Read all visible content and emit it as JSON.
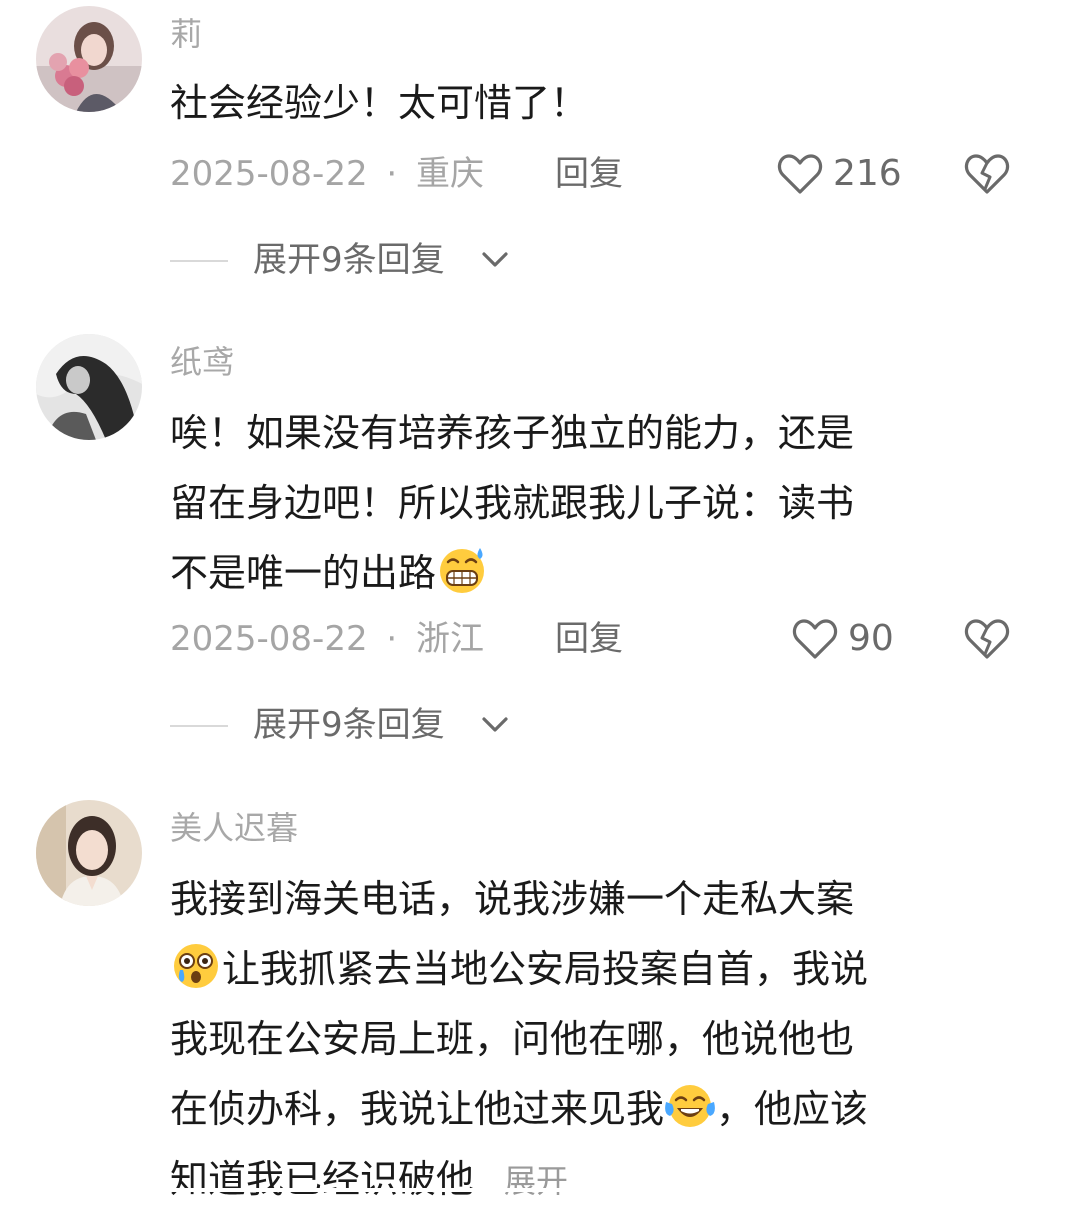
{
  "comments": [
    {
      "username": "莉",
      "text": "社会经验少！太可惜了！",
      "date": "2025-08-22",
      "separator": "·",
      "location": "重庆",
      "reply_label": "回复",
      "likes": "216",
      "expand_label": "展开9条回复"
    },
    {
      "username": "纸鸢",
      "text_line1": "唉！如果没有培养孩子独立的能力，还是",
      "text_line2": "留在身边吧！所以我就跟我儿子说：读书",
      "text_line3": "不是唯一的出路",
      "date": "2025-08-22",
      "separator": "·",
      "location": "浙江",
      "reply_label": "回复",
      "likes": "90",
      "expand_label": "展开9条回复"
    },
    {
      "username": "美人迟暮",
      "text_line1": "我接到海关电话，说我涉嫌一个走私大案",
      "text_line2": "让我抓紧去当地公安局投案自首，我说",
      "text_line3": "我现在公安局上班，问他在哪，他说他也",
      "text_line4a": "在侦办科，我说让他过来见我",
      "text_line4b": "，他应该",
      "text_line5": "知道我已经识破他",
      "more_label": "展开"
    }
  ],
  "icons": {
    "like": "heart-outline-icon",
    "dislike": "broken-heart-icon",
    "expand": "chevron-down-icon",
    "emoji_1": "grinning-sweat-emoji",
    "emoji_2": "flushed-crying-emoji",
    "emoji_3": "tears-of-joy-emoji"
  },
  "colors": {
    "username": "#a8a8a8",
    "text": "#1a1a1a",
    "meta": "#a5a5a5",
    "action": "#6a6a6a"
  }
}
